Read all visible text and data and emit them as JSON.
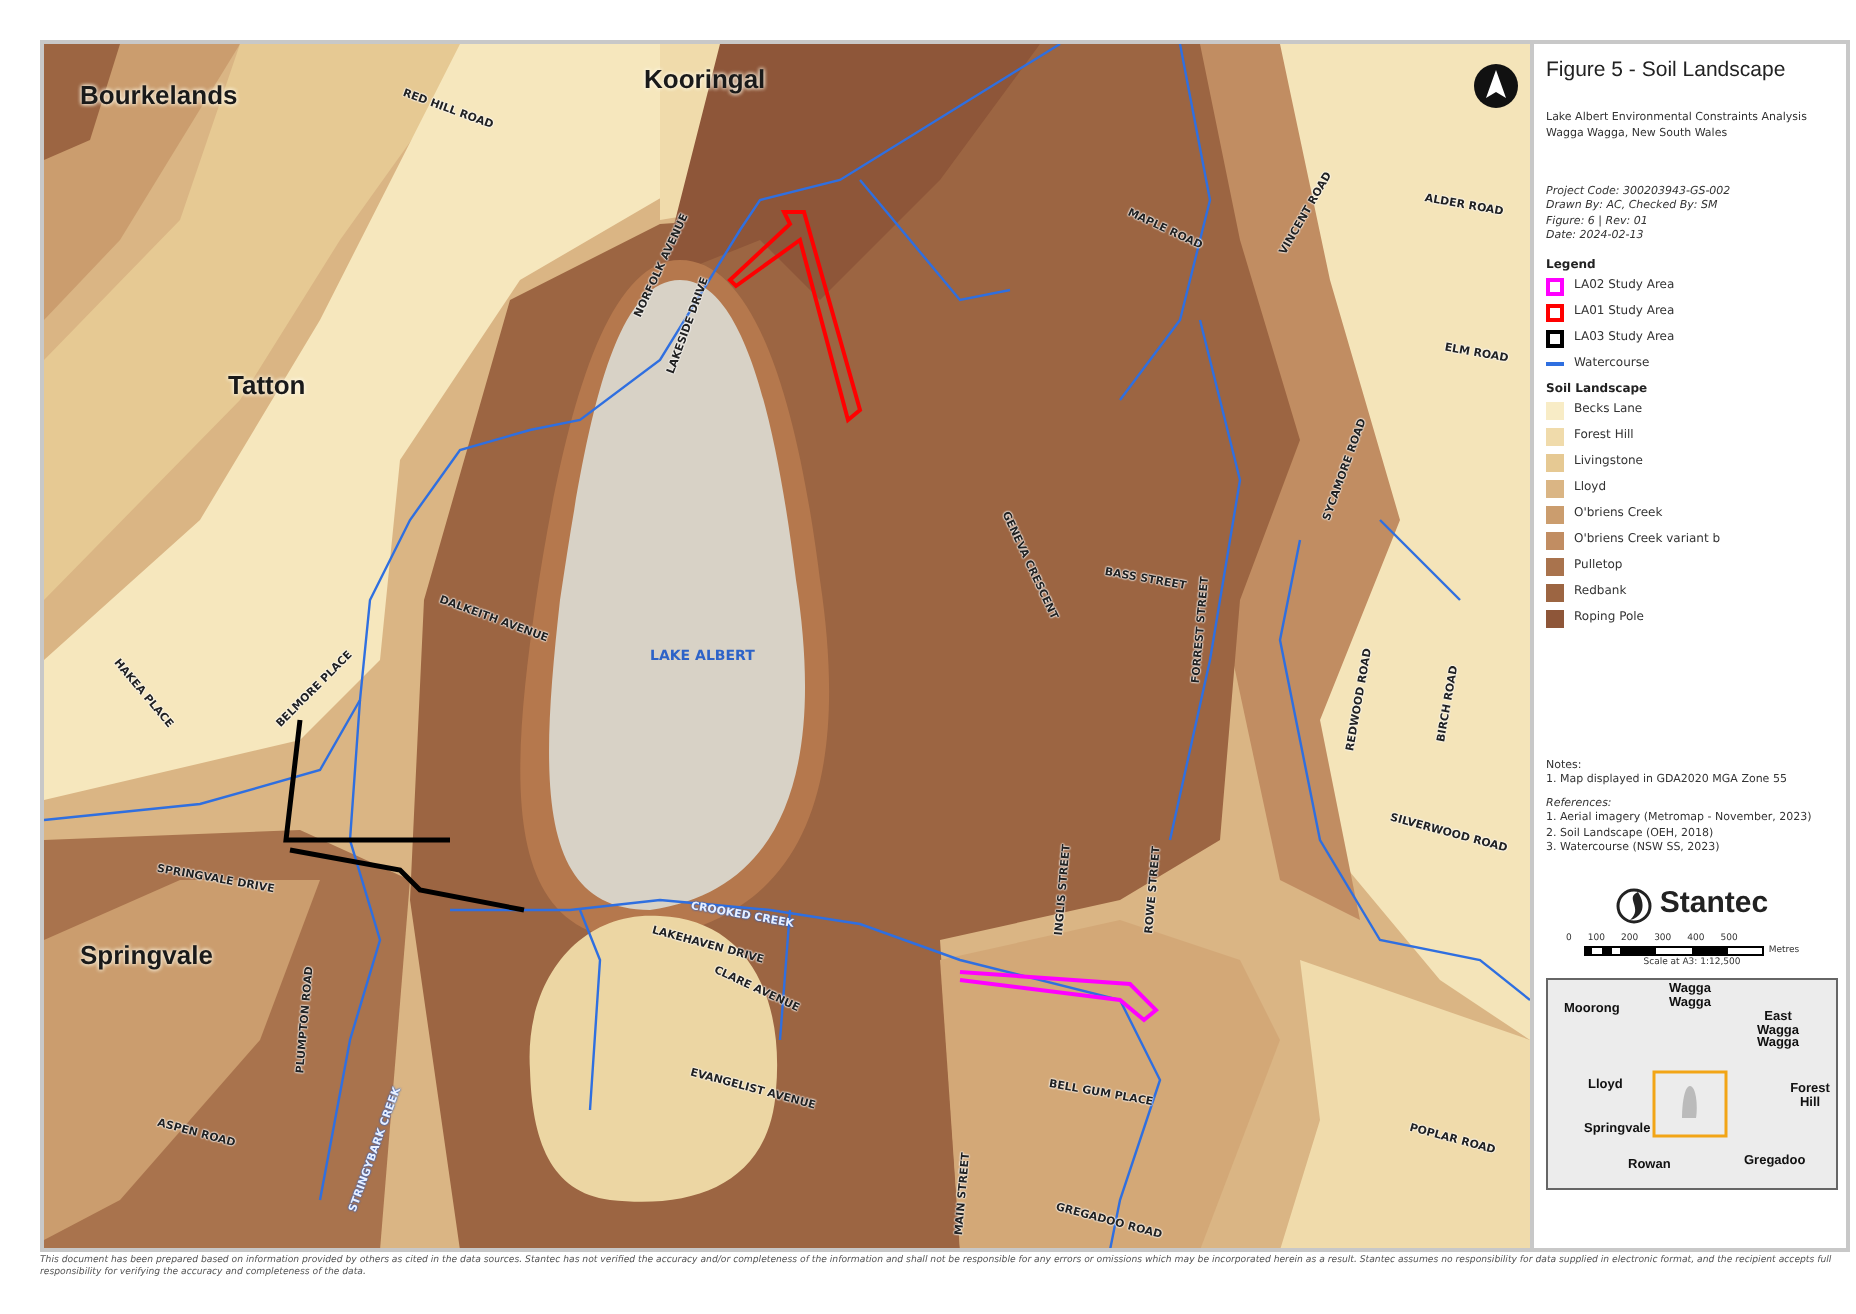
{
  "map": {
    "places": [
      "Bourkelands",
      "Kooringal",
      "Tatton",
      "Springvale"
    ],
    "lake": "LAKE ALBERT",
    "roads": [
      {
        "label": "RED HILL ROAD",
        "kind": "road"
      },
      {
        "label": "NORFOLK AVENUE",
        "kind": "road"
      },
      {
        "label": "LAKESIDE DRIVE",
        "kind": "road"
      },
      {
        "label": "DALKEITH AVENUE",
        "kind": "road"
      },
      {
        "label": "MAPLE ROAD",
        "kind": "road"
      },
      {
        "label": "VINCENT ROAD",
        "kind": "road"
      },
      {
        "label": "ALDER ROAD",
        "kind": "road"
      },
      {
        "label": "ELM ROAD",
        "kind": "road"
      },
      {
        "label": "SYCAMORE ROAD",
        "kind": "road"
      },
      {
        "label": "GENEVA CRESCENT",
        "kind": "road"
      },
      {
        "label": "BASS STREET",
        "kind": "road"
      },
      {
        "label": "FORREST STREET",
        "kind": "road"
      },
      {
        "label": "HAKEA PLACE",
        "kind": "road"
      },
      {
        "label": "BELMORE PLACE",
        "kind": "road"
      },
      {
        "label": "REDWOOD ROAD",
        "kind": "road"
      },
      {
        "label": "BIRCH ROAD",
        "kind": "road"
      },
      {
        "label": "SILVERWOOD ROAD",
        "kind": "road"
      },
      {
        "label": "SPRINGVALE DRIVE",
        "kind": "road"
      },
      {
        "label": "PLUMPTON ROAD",
        "kind": "road"
      },
      {
        "label": "INGLIS STREET",
        "kind": "road"
      },
      {
        "label": "ROWE STREET",
        "kind": "road"
      },
      {
        "label": "LAKEHAVEN DRIVE",
        "kind": "road"
      },
      {
        "label": "CLARE AVENUE",
        "kind": "road"
      },
      {
        "label": "EVANGELIST AVENUE",
        "kind": "road"
      },
      {
        "label": "BELL GUM PLACE",
        "kind": "road"
      },
      {
        "label": "MAIN STREET",
        "kind": "road"
      },
      {
        "label": "POPLAR ROAD",
        "kind": "road"
      },
      {
        "label": "GREGADOO ROAD",
        "kind": "road"
      },
      {
        "label": "ASPEN ROAD",
        "kind": "road"
      },
      {
        "label": "STRINGYBARK CREEK",
        "kind": "creek"
      },
      {
        "label": "CROOKED CREEK",
        "kind": "creek"
      }
    ]
  },
  "panel": {
    "title": "Figure 5 - Soil Landscape",
    "subtitle": [
      "Lake Albert Environmental Constraints Analysis",
      "Wagga Wagga, New South Wales"
    ],
    "project": [
      "Project Code: 300203943-GS-002",
      "Drawn By: AC, Checked By: SM",
      "Figure: 6 | Rev: 01",
      "Date: 2024-02-13"
    ],
    "legend_heading": "Legend",
    "legend": [
      {
        "label": "LA02 Study Area",
        "kind": "study-area",
        "color": "#ff00ff"
      },
      {
        "label": "LA01 Study Area",
        "kind": "study-area",
        "color": "#ff0000"
      },
      {
        "label": "LA03 Study Area",
        "kind": "study-area",
        "color": "#000000"
      },
      {
        "label": "Watercourse",
        "kind": "watercourse",
        "color": "#2f6fe0"
      }
    ],
    "soil_heading": "Soil Landscape",
    "soils": [
      {
        "label": "Becks Lane",
        "color": "#f8ecc6"
      },
      {
        "label": "Forest Hill",
        "color": "#f0dbab"
      },
      {
        "label": "Livingstone",
        "color": "#e6c993"
      },
      {
        "label": "Lloyd",
        "color": "#dab584"
      },
      {
        "label": "O'briens Creek",
        "color": "#cb9d6e"
      },
      {
        "label": "O'briens Creek variant b",
        "color": "#c18d62"
      },
      {
        "label": "Pulletop",
        "color": "#a9734d"
      },
      {
        "label": "Redbank",
        "color": "#9c6542"
      },
      {
        "label": "Roping Pole",
        "color": "#8e5639"
      }
    ],
    "notes_heading": "Notes:",
    "notes": [
      "1. Map displayed in GDA2020 MGA Zone 55"
    ],
    "references_heading": "References:",
    "references": [
      "1. Aerial imagery (Metromap - November, 2023)",
      "2. Soil Landscape (OEH, 2018)",
      "3. Watercourse (NSW SS, 2023)"
    ],
    "logo": "Stantec",
    "scale_ticks": [
      "0",
      "100",
      "200",
      "300",
      "400",
      "500"
    ],
    "scale_unit": "Metres",
    "scale_caption": "Scale at A3: 1:12,500",
    "inset_places": [
      "Moorong",
      "Wagga Wagga",
      "East Wagga Wagga",
      "Lloyd",
      "Springvale",
      "Forest Hill",
      "Rowan",
      "Gregadoo"
    ]
  },
  "disclaimer": "This document has been prepared based on information provided by others as cited in the data sources. Stantec has not verified the accuracy and/or completeness of the information and shall not be responsible for any errors or omissions which may be incorporated herein as a result. Stantec assumes no responsibility for data supplied in electronic format, and the recipient accepts full responsibility for verifying the accuracy and completeness of the data."
}
